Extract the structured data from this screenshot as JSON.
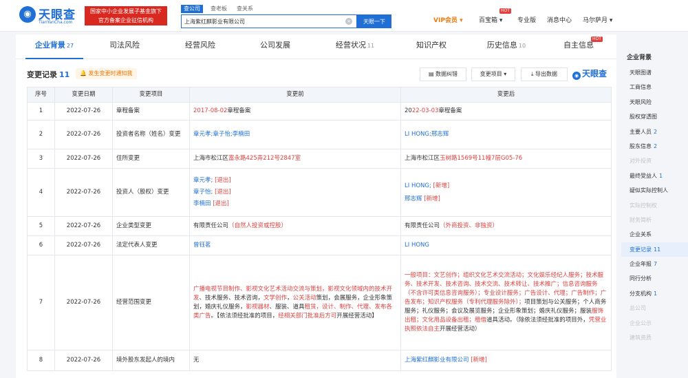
{
  "header": {
    "logo_text": "天眼查",
    "logo_sub": "TianYanCha.com",
    "banner_line1": "国家中小企业发展子基金旗下",
    "banner_line2": "官方备案企业征信机构",
    "search_tabs": [
      "查公司",
      "查老板",
      "查关系"
    ],
    "search_value": "上海紫红麒影业有限公司",
    "search_button": "天眼一下",
    "nav": {
      "vip": "VIP会员",
      "baobao": "百宝箱",
      "hot": "HOT",
      "pro": "专业版",
      "messages": "消息中心",
      "user": "马尔萨月"
    }
  },
  "tabs": [
    {
      "label": "企业背景",
      "count": "27"
    },
    {
      "label": "司法风险",
      "count": ""
    },
    {
      "label": "经营风险",
      "count": ""
    },
    {
      "label": "公司发展",
      "count": ""
    },
    {
      "label": "经营状况",
      "count": "11"
    },
    {
      "label": "知识产权",
      "count": ""
    },
    {
      "label": "历史信息",
      "count": "10"
    },
    {
      "label": "自主信息",
      "count": ""
    }
  ],
  "tab_hot": "HOT",
  "section": {
    "title": "变更记录",
    "count": "11",
    "notify": "发生变更时通知我",
    "btn_correct": "数据纠错",
    "btn_filter": "变更项目",
    "btn_export": "导出数据",
    "watermark": "天眼查"
  },
  "table": {
    "headers": [
      "序号",
      "变更日期",
      "变更项目",
      "变更前",
      "变更后"
    ],
    "rows": [
      {
        "no": "1",
        "date": "2022-07-26",
        "item": "章程备案"
      },
      {
        "no": "2",
        "date": "2022-07-26",
        "item": "投资者名称（姓名）变更"
      },
      {
        "no": "3",
        "date": "2022-07-26",
        "item": "住所变更"
      },
      {
        "no": "4",
        "date": "2022-07-26",
        "item": "投资人（股权）变更"
      },
      {
        "no": "5",
        "date": "2022-07-26",
        "item": "企业类型变更"
      },
      {
        "no": "6",
        "date": "2022-07-26",
        "item": "法定代表人变更"
      },
      {
        "no": "7",
        "date": "2022-07-26",
        "item": "经营范围变更"
      },
      {
        "no": "8",
        "date": "2022-07-26",
        "item": "境外股东发起人的境内"
      }
    ],
    "r1_before_a": "2017-08-02",
    "r1_before_b": "章程备案",
    "r1_after_a": "20",
    "r1_after_b": "22-03-03",
    "r1_after_c": "章程备案",
    "r2_before": "章元孝;章子怡;李楠田",
    "r2_after": "LI HONG;邢志辉",
    "r3_before_a": "上海市松江区",
    "r3_before_b": "富永路425弄212号2847室",
    "r3_after_a": "上海市松江区",
    "r3_after_b": "玉树路1569号11幢7层G05-76",
    "r4_before": [
      {
        "name": "章元孝;",
        "tag": "[退出]"
      },
      {
        "name": "章子怡;",
        "tag": "[退出]"
      },
      {
        "name": "李楠田",
        "tag": "[退出]"
      }
    ],
    "r4_after": [
      {
        "name": "LI HONG;",
        "tag": "[新增]"
      },
      {
        "name": "邢志辉",
        "tag": "[新增]"
      }
    ],
    "r5_before_a": "有限责任公司",
    "r5_before_b": "（自然人投资或控股）",
    "r5_after_a": "有限责任公司",
    "r5_after_b": "（外商投资、非独资）",
    "r6_before": "曾钰茗",
    "r6_after": "LI HONG",
    "r7_before": [
      {
        "t": "广播电视节目制作、影视文化艺术活动交流与策划，影视文化领域内的技术开发",
        "r": true
      },
      {
        "t": "、技术服务、技术咨询，",
        "r": false
      },
      {
        "t": "文学创作",
        "r": true
      },
      {
        "t": "，",
        "r": false
      },
      {
        "t": "公关活动",
        "r": true
      },
      {
        "t": "策划，会展服务，企业形象策划，婚庆礼仪服务，",
        "r": false
      },
      {
        "t": "影视器材",
        "r": true
      },
      {
        "t": "、服装、道具",
        "r": false
      },
      {
        "t": "租赁，设计、制作、代理、发布各类广告",
        "r": true
      },
      {
        "t": "。【依法须经批准的项目，",
        "r": false
      },
      {
        "t": "经相关部门批准后方可",
        "r": true
      },
      {
        "t": "开展经营活动】",
        "r": false
      }
    ],
    "r7_after": [
      {
        "t": "一般项目：文艺创作；组织文化艺术交流活动；文化娱乐经纪人服务；技术服务、技术开发、技术咨询、技术交流、技术转让、技术推广；信息咨询服务（不含许可类信息咨询服务）；专业设计服务；广告设计、代理；广告制作；广告发布；知识产权服务（专利代理服务除外）；",
        "r": true
      },
      {
        "t": "项目策划与公关服务；个人商务服务；礼仪服务；会议及展览服务；企业形象策划；婚庆礼仪服务；服装",
        "r": false
      },
      {
        "t": "服饰出租；文化用品设备出租；租借",
        "r": true
      },
      {
        "t": "道具活动。（除依法须经批准的项目外，",
        "r": false
      },
      {
        "t": "凭营业执照依法自主",
        "r": true
      },
      {
        "t": "开展经营活动）",
        "r": false
      }
    ],
    "r8_before": "无",
    "r8_after_name": "上海紫红麒影业有限公司",
    "r8_after_tag": "[新增]"
  },
  "sidebar": {
    "title": "企业背景",
    "items": [
      {
        "label": "天眼图谱",
        "count": "",
        "dim": false
      },
      {
        "label": "工商信息",
        "count": "",
        "dim": false
      },
      {
        "label": "天眼风险",
        "count": "",
        "dim": false
      },
      {
        "label": "股权穿透图",
        "count": "",
        "dim": false
      },
      {
        "label": "主要人员",
        "count": "2",
        "dim": false
      },
      {
        "label": "股东信息",
        "count": "2",
        "dim": false
      },
      {
        "label": "对外投资",
        "count": "",
        "dim": true
      },
      {
        "label": "最终受益人",
        "count": "1",
        "dim": false
      },
      {
        "label": "疑似实际控制人",
        "count": "",
        "dim": false
      },
      {
        "label": "实际控制权",
        "count": "",
        "dim": true
      },
      {
        "label": "财务简析",
        "count": "",
        "dim": true
      },
      {
        "label": "企业关系",
        "count": "",
        "dim": false
      },
      {
        "label": "变更记录",
        "count": "11",
        "dim": false,
        "active": true
      },
      {
        "label": "企业年报",
        "count": "7",
        "dim": false
      },
      {
        "label": "同行分析",
        "count": "",
        "dim": false
      },
      {
        "label": "分支机构",
        "count": "1",
        "dim": false
      },
      {
        "label": "总公司",
        "count": "",
        "dim": true
      },
      {
        "label": "企业公示",
        "count": "",
        "dim": true
      },
      {
        "label": "建筑资质",
        "count": "",
        "dim": true
      }
    ]
  },
  "colors": {
    "brand": "#1f6fd6",
    "accent_red": "#e1403f",
    "vip": "#f07a0c"
  }
}
